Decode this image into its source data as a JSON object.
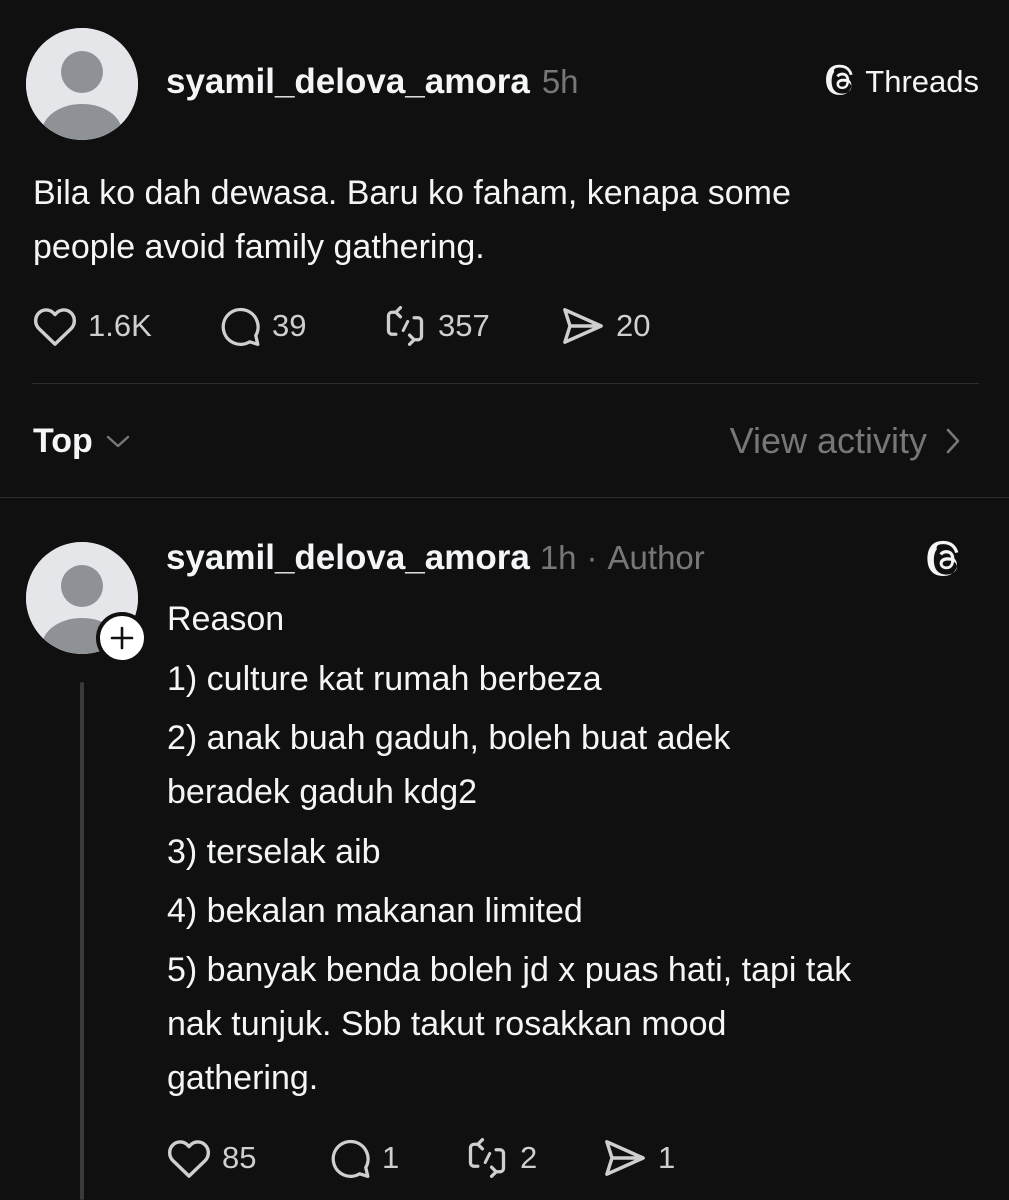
{
  "post": {
    "username": "syamil_delova_amora",
    "time": "5h",
    "brand_label": "Threads",
    "brand_icon": "threads-logo-icon",
    "text_lines": [
      "Bila ko dah dewasa. Baru ko faham, kenapa some",
      "people avoid family gathering."
    ],
    "stats": {
      "likes": "1.6K",
      "replies": "39",
      "reposts": "357",
      "shares": "20"
    }
  },
  "replies_header": {
    "sort_label": "Top",
    "view_activity_label": "View activity"
  },
  "reply": {
    "username": "syamil_delova_amora",
    "time": "1h",
    "separator": "·",
    "role": "Author",
    "brand_icon": "threads-logo-icon",
    "lines": [
      "Reason",
      "1) culture kat rumah berbeza",
      "2) anak buah gaduh, boleh buat adek",
      "beradek gaduh kdg2",
      "3) terselak aib",
      "4) bekalan makanan limited",
      "5) banyak benda boleh jd x puas hati, tapi tak",
      "nak tunjuk. Sbb takut rosakkan mood",
      "gathering."
    ],
    "stats": {
      "likes": "85",
      "replies": "1",
      "reposts": "2",
      "shares": "1"
    }
  },
  "colors": {
    "background": "#101010",
    "text_primary": "#f3f5f7",
    "text_secondary": "#777777",
    "divider": "#2e2e2e"
  }
}
